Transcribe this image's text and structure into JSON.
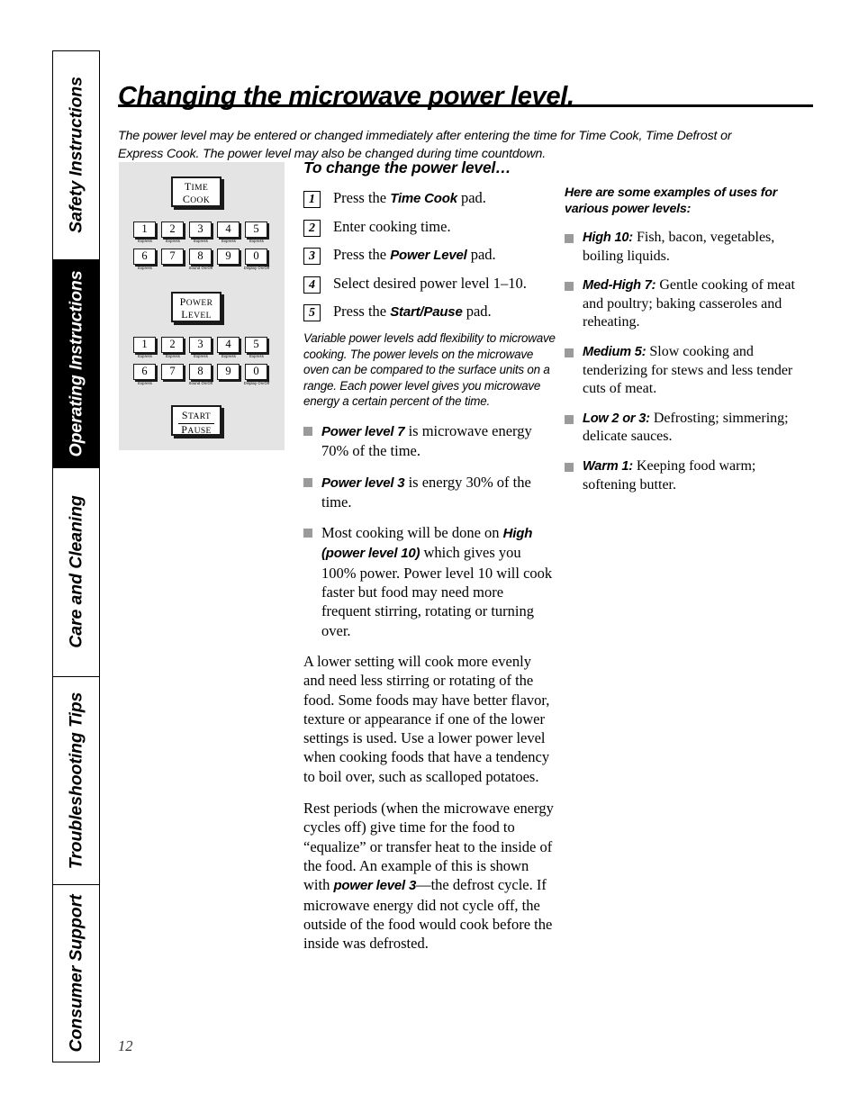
{
  "page": {
    "title": "Changing the microwave power level.",
    "intro": "The power level may be entered or changed immediately after entering the time for Time Cook, Time Defrost or Express Cook. The power level may also be changed during time countdown.",
    "page_number": "12"
  },
  "side_tabs": [
    {
      "label": "Safety Instructions",
      "active": false
    },
    {
      "label": "Operating Instructions",
      "active": true
    },
    {
      "label": "Care and Cleaning",
      "active": false
    },
    {
      "label": "Troubleshooting Tips",
      "active": false
    },
    {
      "label": "Consumer Support",
      "active": false
    }
  ],
  "keypad": {
    "time_cook": {
      "line1": "Time",
      "line2": "Cook"
    },
    "power_level": {
      "line1": "Power",
      "line2": "Level"
    },
    "start_pause": {
      "line1": "Start",
      "line2": "Pause"
    },
    "keys_row1": [
      {
        "digit": "1",
        "sub": "Express"
      },
      {
        "digit": "2",
        "sub": "Express"
      },
      {
        "digit": "3",
        "sub": "Express"
      },
      {
        "digit": "4",
        "sub": "Express"
      },
      {
        "digit": "5",
        "sub": "Express"
      }
    ],
    "keys_row2": [
      {
        "digit": "6",
        "sub": "Express"
      },
      {
        "digit": "7",
        "sub": ""
      },
      {
        "digit": "8",
        "sub": "Sound On/Off"
      },
      {
        "digit": "9",
        "sub": ""
      },
      {
        "digit": "0",
        "sub": "Display On/Off"
      }
    ]
  },
  "steps_section": {
    "heading": "To change the power level…",
    "steps": [
      {
        "num": "1",
        "text_before": "Press the ",
        "bold": "Time Cook",
        "text_after": " pad."
      },
      {
        "num": "2",
        "text_before": "Enter cooking time.",
        "bold": "",
        "text_after": ""
      },
      {
        "num": "3",
        "text_before": "Press the ",
        "bold": "Power Level",
        "text_after": " pad."
      },
      {
        "num": "4",
        "text_before": "Select desired power level 1–10.",
        "bold": "",
        "text_after": ""
      },
      {
        "num": "5",
        "text_before": "Press the ",
        "bold": "Start/Pause",
        "text_after": " pad."
      }
    ],
    "variable_note": "Variable power levels add flexibility to microwave cooking. The power levels on the microwave oven can be compared to the surface units on a range. Each power level gives you microwave energy a certain percent of the time.",
    "bullets": [
      {
        "bold": "Power level 7",
        "text": "  is microwave energy 70% of the time."
      },
      {
        "bold": "Power level 3",
        "text": "  is energy 30% of the time."
      },
      {
        "bold_inline_prefix": "Most cooking will be done on ",
        "bold": "High (power level 10)",
        "text": "  which gives you 100% power. Power level 10 will cook faster but food may need more frequent stirring, rotating or turning over."
      }
    ],
    "paragraphs": [
      "A lower setting will cook more evenly and need less stirring or rotating of the food. Some foods may have better flavor, texture or appearance if one of the lower settings is used. Use a lower power level when cooking foods that have a tendency to boil over, such as scalloped potatoes.",
      "Rest periods (when the microwave energy cycles off) give time for the food to “equalize” or transfer heat to the inside of the food. An example of this is shown with "
    ],
    "last_para_bold": "power level 3",
    "last_para_tail": "—the defrost cycle. If microwave energy did not cycle off, the outside of the food would cook before the inside was defrosted."
  },
  "examples_section": {
    "heading": "Here are some examples of uses for various power levels:",
    "bullets": [
      {
        "bold": "High 10:",
        "text": "  Fish, bacon, vegetables, boiling liquids."
      },
      {
        "bold": "Med-High 7:",
        "text": "  Gentle cooking of meat and poultry; baking casseroles and reheating."
      },
      {
        "bold": "Medium 5:",
        "text": "  Slow cooking and tenderizing for stews and less tender cuts of meat."
      },
      {
        "bold": "Low 2 or 3:",
        "text": "  Defrosting; simmering; delicate sauces."
      },
      {
        "bold": "Warm 1:",
        "text": "  Keeping food warm; softening butter."
      }
    ]
  },
  "colors": {
    "panel_gray": "#e4e4e4",
    "bullet_gray": "#9a9a9a",
    "ink": "#000000"
  }
}
